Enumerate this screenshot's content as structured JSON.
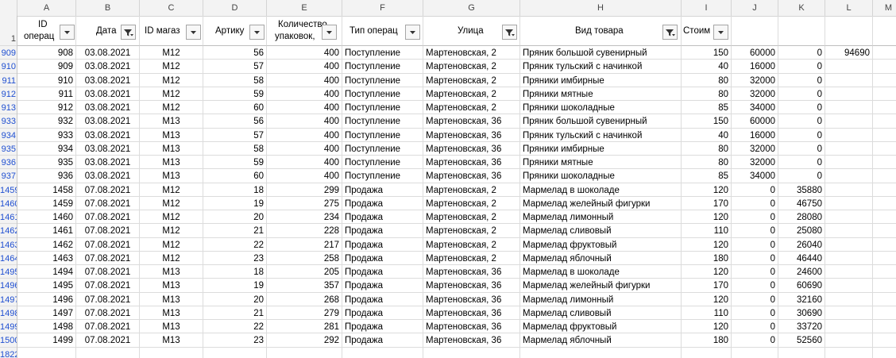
{
  "columns": [
    "A",
    "B",
    "C",
    "D",
    "E",
    "F",
    "G",
    "H",
    "I",
    "J",
    "K",
    "L",
    "M"
  ],
  "header_row_number": "1",
  "headers": {
    "a_line1": "ID",
    "a_line2": "операц",
    "b": "Дата",
    "c": "ID магаз",
    "d": "Артику",
    "e_line1": "Количество",
    "e_line2": "упаковок,",
    "f": "Тип операц",
    "g": "Улица",
    "h": "Вид товара",
    "i": "Стоим"
  },
  "filters": {
    "a": "dropdown-icon",
    "b": "filter-active-icon",
    "c": "dropdown-icon",
    "d": "dropdown-icon",
    "e": "dropdown-icon",
    "f": "dropdown-icon",
    "g": "filter-active-icon",
    "h": "filter-active-icon",
    "i": "dropdown-icon"
  },
  "rows": [
    {
      "n": "909",
      "a": "908",
      "b": "03.08.2021",
      "c": "M12",
      "d": "56",
      "e": "400",
      "f": "Поступление",
      "g": "Мартеновская, 2",
      "h": "Пряник большой сувенирный",
      "i": "150",
      "j": "60000",
      "k": "0",
      "l": "94690"
    },
    {
      "n": "910",
      "a": "909",
      "b": "03.08.2021",
      "c": "M12",
      "d": "57",
      "e": "400",
      "f": "Поступление",
      "g": "Мартеновская, 2",
      "h": "Пряник тульский с начинкой",
      "i": "40",
      "j": "16000",
      "k": "0",
      "l": ""
    },
    {
      "n": "911",
      "a": "910",
      "b": "03.08.2021",
      "c": "M12",
      "d": "58",
      "e": "400",
      "f": "Поступление",
      "g": "Мартеновская, 2",
      "h": "Пряники имбирные",
      "i": "80",
      "j": "32000",
      "k": "0",
      "l": ""
    },
    {
      "n": "912",
      "a": "911",
      "b": "03.08.2021",
      "c": "M12",
      "d": "59",
      "e": "400",
      "f": "Поступление",
      "g": "Мартеновская, 2",
      "h": "Пряники мятные",
      "i": "80",
      "j": "32000",
      "k": "0",
      "l": ""
    },
    {
      "n": "913",
      "a": "912",
      "b": "03.08.2021",
      "c": "M12",
      "d": "60",
      "e": "400",
      "f": "Поступление",
      "g": "Мартеновская, 2",
      "h": "Пряники шоколадные",
      "i": "85",
      "j": "34000",
      "k": "0",
      "l": ""
    },
    {
      "n": "933",
      "a": "932",
      "b": "03.08.2021",
      "c": "M13",
      "d": "56",
      "e": "400",
      "f": "Поступление",
      "g": "Мартеновская, 36",
      "h": "Пряник большой сувенирный",
      "i": "150",
      "j": "60000",
      "k": "0",
      "l": ""
    },
    {
      "n": "934",
      "a": "933",
      "b": "03.08.2021",
      "c": "M13",
      "d": "57",
      "e": "400",
      "f": "Поступление",
      "g": "Мартеновская, 36",
      "h": "Пряник тульский с начинкой",
      "i": "40",
      "j": "16000",
      "k": "0",
      "l": ""
    },
    {
      "n": "935",
      "a": "934",
      "b": "03.08.2021",
      "c": "M13",
      "d": "58",
      "e": "400",
      "f": "Поступление",
      "g": "Мартеновская, 36",
      "h": "Пряники имбирные",
      "i": "80",
      "j": "32000",
      "k": "0",
      "l": ""
    },
    {
      "n": "936",
      "a": "935",
      "b": "03.08.2021",
      "c": "M13",
      "d": "59",
      "e": "400",
      "f": "Поступление",
      "g": "Мартеновская, 36",
      "h": "Пряники мятные",
      "i": "80",
      "j": "32000",
      "k": "0",
      "l": ""
    },
    {
      "n": "937",
      "a": "936",
      "b": "03.08.2021",
      "c": "M13",
      "d": "60",
      "e": "400",
      "f": "Поступление",
      "g": "Мартеновская, 36",
      "h": "Пряники шоколадные",
      "i": "85",
      "j": "34000",
      "k": "0",
      "l": ""
    },
    {
      "n": "1459",
      "a": "1458",
      "b": "07.08.2021",
      "c": "M12",
      "d": "18",
      "e": "299",
      "f": "Продажа",
      "g": "Мартеновская, 2",
      "h": "Мармелад в шоколаде",
      "i": "120",
      "j": "0",
      "k": "35880",
      "l": ""
    },
    {
      "n": "1460",
      "a": "1459",
      "b": "07.08.2021",
      "c": "M12",
      "d": "19",
      "e": "275",
      "f": "Продажа",
      "g": "Мартеновская, 2",
      "h": "Мармелад желейный фигурки",
      "i": "170",
      "j": "0",
      "k": "46750",
      "l": ""
    },
    {
      "n": "1461",
      "a": "1460",
      "b": "07.08.2021",
      "c": "M12",
      "d": "20",
      "e": "234",
      "f": "Продажа",
      "g": "Мартеновская, 2",
      "h": "Мармелад лимонный",
      "i": "120",
      "j": "0",
      "k": "28080",
      "l": ""
    },
    {
      "n": "1462",
      "a": "1461",
      "b": "07.08.2021",
      "c": "M12",
      "d": "21",
      "e": "228",
      "f": "Продажа",
      "g": "Мартеновская, 2",
      "h": "Мармелад сливовый",
      "i": "110",
      "j": "0",
      "k": "25080",
      "l": ""
    },
    {
      "n": "1463",
      "a": "1462",
      "b": "07.08.2021",
      "c": "M12",
      "d": "22",
      "e": "217",
      "f": "Продажа",
      "g": "Мартеновская, 2",
      "h": "Мармелад фруктовый",
      "i": "120",
      "j": "0",
      "k": "26040",
      "l": ""
    },
    {
      "n": "1464",
      "a": "1463",
      "b": "07.08.2021",
      "c": "M12",
      "d": "23",
      "e": "258",
      "f": "Продажа",
      "g": "Мартеновская, 2",
      "h": "Мармелад яблочный",
      "i": "180",
      "j": "0",
      "k": "46440",
      "l": ""
    },
    {
      "n": "1495",
      "a": "1494",
      "b": "07.08.2021",
      "c": "M13",
      "d": "18",
      "e": "205",
      "f": "Продажа",
      "g": "Мартеновская, 36",
      "h": "Мармелад в шоколаде",
      "i": "120",
      "j": "0",
      "k": "24600",
      "l": ""
    },
    {
      "n": "1496",
      "a": "1495",
      "b": "07.08.2021",
      "c": "M13",
      "d": "19",
      "e": "357",
      "f": "Продажа",
      "g": "Мартеновская, 36",
      "h": "Мармелад желейный фигурки",
      "i": "170",
      "j": "0",
      "k": "60690",
      "l": ""
    },
    {
      "n": "1497",
      "a": "1496",
      "b": "07.08.2021",
      "c": "M13",
      "d": "20",
      "e": "268",
      "f": "Продажа",
      "g": "Мартеновская, 36",
      "h": "Мармелад лимонный",
      "i": "120",
      "j": "0",
      "k": "32160",
      "l": ""
    },
    {
      "n": "1498",
      "a": "1497",
      "b": "07.08.2021",
      "c": "M13",
      "d": "21",
      "e": "279",
      "f": "Продажа",
      "g": "Мартеновская, 36",
      "h": "Мармелад сливовый",
      "i": "110",
      "j": "0",
      "k": "30690",
      "l": ""
    },
    {
      "n": "1499",
      "a": "1498",
      "b": "07.08.2021",
      "c": "M13",
      "d": "22",
      "e": "281",
      "f": "Продажа",
      "g": "Мартеновская, 36",
      "h": "Мармелад фруктовый",
      "i": "120",
      "j": "0",
      "k": "33720",
      "l": ""
    },
    {
      "n": "1500",
      "a": "1499",
      "b": "07.08.2021",
      "c": "M13",
      "d": "23",
      "e": "292",
      "f": "Продажа",
      "g": "Мартеновская, 36",
      "h": "Мармелад яблочный",
      "i": "180",
      "j": "0",
      "k": "52560",
      "l": ""
    }
  ],
  "trailing_row_number": "1822",
  "colors": {
    "row_number_text": "#1f4fd1",
    "header_bg": "#f3f3f3",
    "gridline": "#dcdcdc"
  }
}
